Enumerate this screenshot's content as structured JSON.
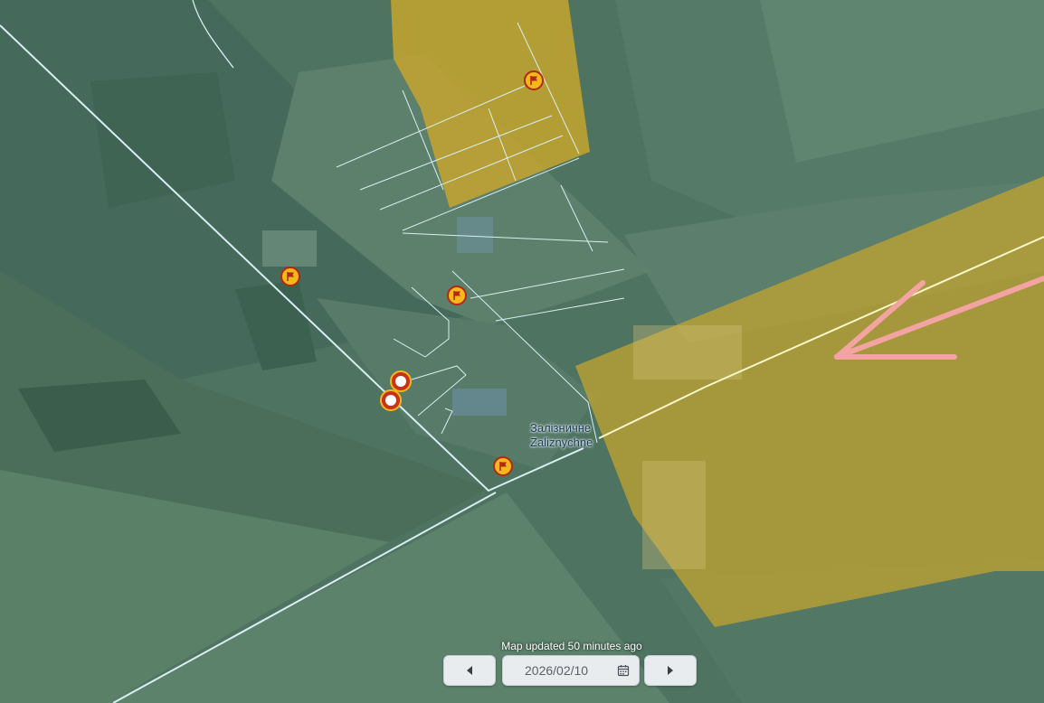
{
  "map": {
    "settlement": {
      "name_ukrainian": "Залізничне",
      "name_latin": "Zaliznychne"
    },
    "colors": {
      "controlled_area": "#c9a62c",
      "attack_arrow": "#f4a3a3",
      "road": "#d8eef2",
      "rail": "#fff7c8",
      "marker_fill": "#f5b81c",
      "marker_border": "#b02a12"
    },
    "markers": [
      {
        "type": "flag",
        "icon": "flag-icon"
      },
      {
        "type": "flag",
        "icon": "flag-icon"
      },
      {
        "type": "flag",
        "icon": "flag-icon"
      },
      {
        "type": "flag",
        "icon": "flag-icon"
      },
      {
        "type": "point",
        "icon": "circle-icon"
      },
      {
        "type": "point",
        "icon": "circle-icon"
      }
    ]
  },
  "footer": {
    "updated_text": "Map updated 50 minutes ago",
    "date": "2026/02/10",
    "prev_icon": "chevron-left-icon",
    "next_icon": "chevron-right-icon",
    "calendar_icon": "calendar-icon"
  }
}
